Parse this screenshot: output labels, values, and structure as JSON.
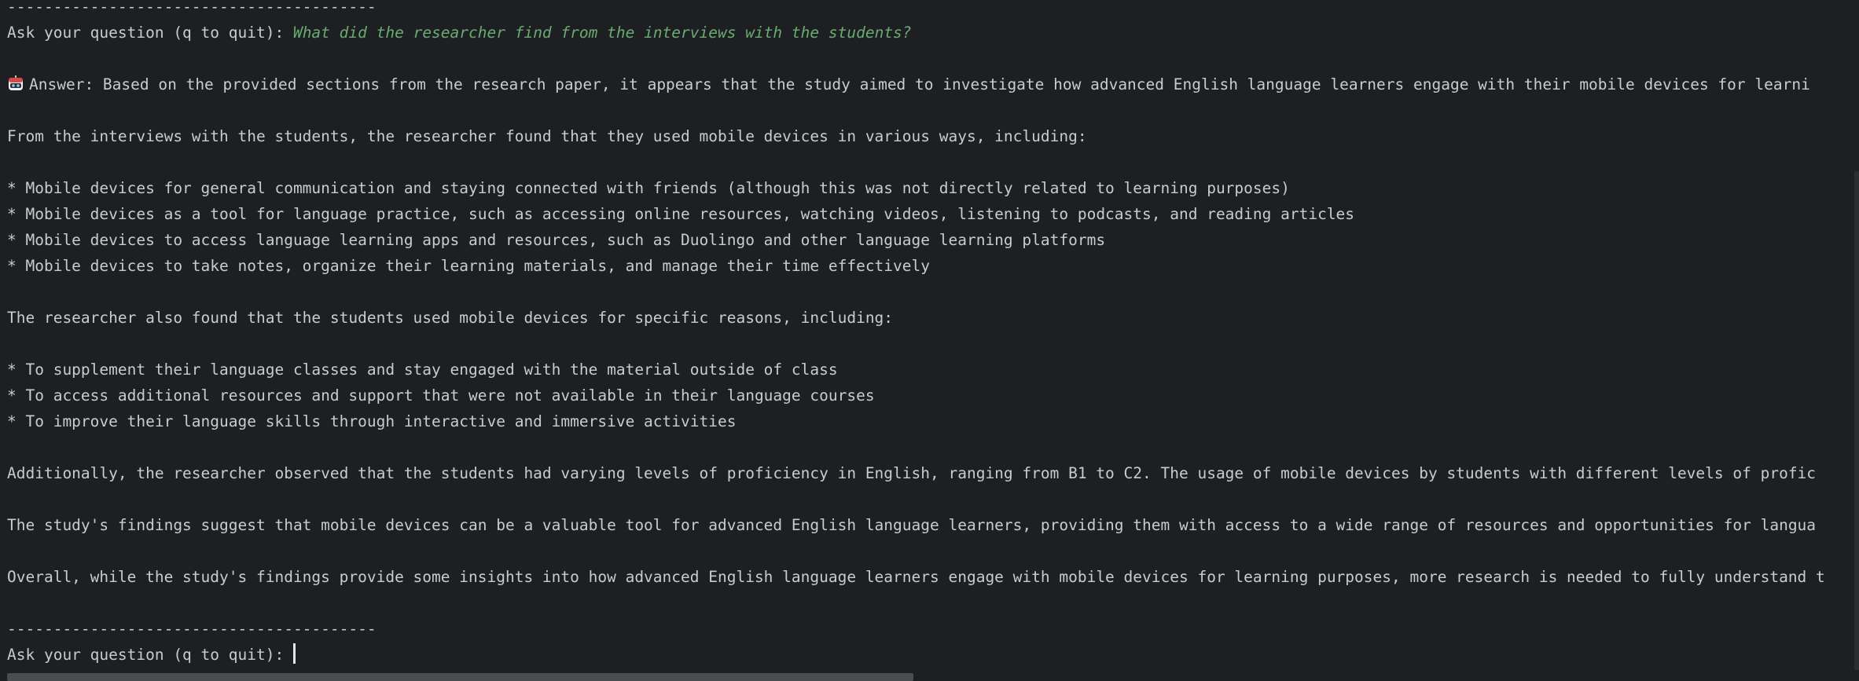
{
  "terminal": {
    "separator_top": "----------------------------------------",
    "prompt_label": "Ask your question (q to quit): ",
    "question": "What did the researcher find from the interviews with the students?",
    "answer_icon": "robot-icon",
    "answer_line": "Answer: Based on the provided sections from the research paper, it appears that the study aimed to investigate how advanced English language learners engage with their mobile devices for learni",
    "interviews_intro": "From the interviews with the students, the researcher found that they used mobile devices in various ways, including:",
    "usage_items": [
      "* Mobile devices for general communication and staying connected with friends (although this was not directly related to learning purposes)",
      "* Mobile devices as a tool for language practice, such as accessing online resources, watching videos, listening to podcasts, and reading articles",
      "* Mobile devices to access language learning apps and resources, such as Duolingo and other language learning platforms",
      "* Mobile devices to take notes, organize their learning materials, and manage their time effectively"
    ],
    "reasons_intro": "The researcher also found that the students used mobile devices for specific reasons, including:",
    "reason_items": [
      "* To supplement their language classes and stay engaged with the material outside of class",
      "* To access additional resources and support that were not available in their language courses",
      "* To improve their language skills through interactive and immersive activities"
    ],
    "additionally_line": "Additionally, the researcher observed that the students had varying levels of proficiency in English, ranging from B1 to C2. The usage of mobile devices by students with different levels of profic",
    "findings_line": "The study's findings suggest that mobile devices can be a valuable tool for advanced English language learners, providing them with access to a wide range of resources and opportunities for langua",
    "overall_line": "Overall, while the study's findings provide some insights into how advanced English language learners engage with mobile devices for learning purposes, more research is needed to fully understand t",
    "separator_bottom": "----------------------------------------",
    "prompt_label_bottom": "Ask your question (q to quit): "
  },
  "colors": {
    "background": "#1e1f22",
    "text": "#c8cbd0",
    "question": "#6aab73"
  }
}
